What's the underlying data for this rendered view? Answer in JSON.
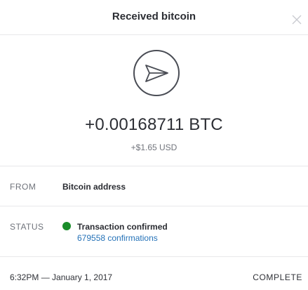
{
  "header": {
    "title": "Received bitcoin",
    "close_icon": "close-icon"
  },
  "summary": {
    "icon": "send-paper-plane-icon",
    "amount_btc": "+0.00168711 BTC",
    "amount_usd": "+$1.65 USD"
  },
  "details": {
    "from": {
      "label": "FROM",
      "value": "Bitcoin address"
    },
    "status": {
      "label": "STATUS",
      "value": "Transaction confirmed",
      "confirmations": "679558 confirmations",
      "indicator_color": "#1a8d2a"
    }
  },
  "footer": {
    "timestamp": "6:32PM — January 1, 2017",
    "state": "COMPLETE"
  },
  "colors": {
    "link": "#2572b8",
    "divider": "#e8e8ea",
    "text": "#2a2c32",
    "muted": "#6f737b"
  }
}
